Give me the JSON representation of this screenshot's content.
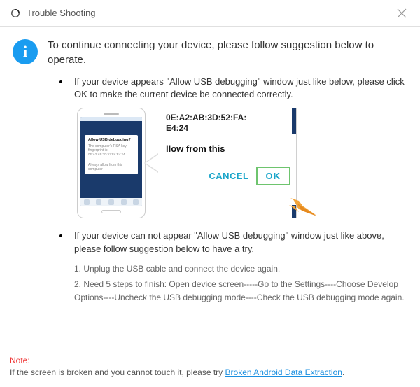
{
  "titlebar": {
    "title": "Trouble Shooting"
  },
  "lead": "To continue connecting your device, please follow suggestion below to operate.",
  "step1": {
    "text": "If your device appears \"Allow USB debugging\" window just like below, please click OK to make the current device  be connected correctly.",
    "phone_dialog_title": "Allow USB debugging?",
    "phone_dialog_body1": "The computer's RSA key fingerprint is:",
    "phone_dialog_body2": "0E:A2:AB:3D:52:FA:E4:24",
    "phone_dialog_check": "Always allow from this computer",
    "zoom_mac1": "0E:A2:AB:3D:52:FA:",
    "zoom_mac2": "E4:24",
    "zoom_allow": "llow from this",
    "zoom_cancel": "CANCEL",
    "zoom_ok": "OK"
  },
  "step2": {
    "text": "If your device can not appear \"Allow USB debugging\" window just like above, please follow suggestion below to have a try.",
    "sub1": "1. Unplug the USB cable and connect the device again.",
    "sub2": "2. Need 5 steps to finish: Open device screen-----Go to the Settings----Choose Develop Options----Uncheck the USB debugging mode----Check the USB debugging mode again."
  },
  "footer": {
    "note_label": "Note:",
    "text": "If the screen is broken and you cannot touch it, please try ",
    "link": "Broken Android Data Extraction",
    "tail": "."
  }
}
